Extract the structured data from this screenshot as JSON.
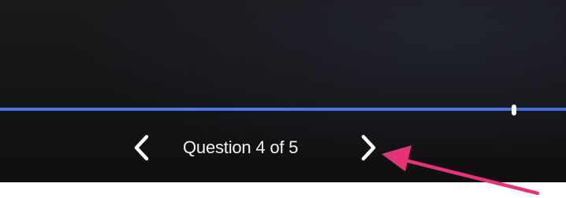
{
  "player": {
    "progress_fraction": 0.908,
    "colors": {
      "progress": "#4a76e6",
      "handle": "#ffffff",
      "background": "#141416",
      "annotation": "#e5337a"
    }
  },
  "navigation": {
    "prev_icon": "chevron-left-icon",
    "next_icon": "chevron-right-icon",
    "question_label": "Question 4 of 5"
  },
  "annotation": {
    "icon": "pink-arrow-icon"
  }
}
